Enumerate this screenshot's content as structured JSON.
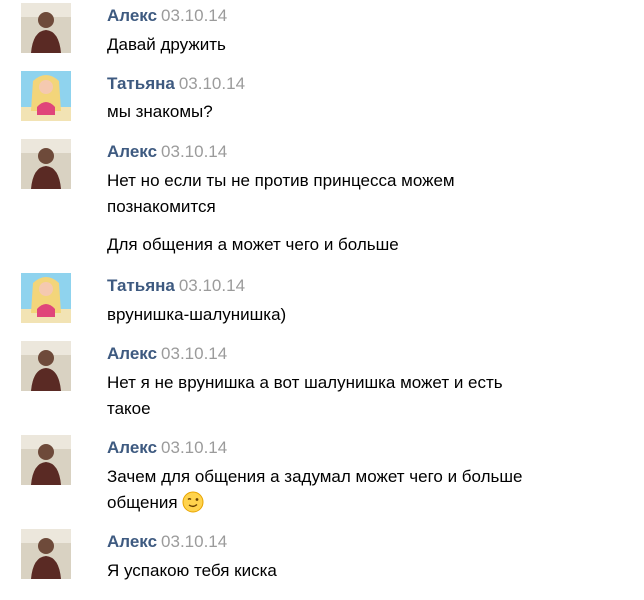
{
  "messages": [
    {
      "author": "Алекс",
      "date": "03.10.14",
      "avatar": "man-avatar-icon",
      "lines": [
        "Давай дружить"
      ]
    },
    {
      "author": "Татьяна",
      "date": "03.10.14",
      "avatar": "woman-avatar-icon",
      "lines": [
        "мы знакомы?"
      ]
    },
    {
      "author": "Алекс",
      "date": "03.10.14",
      "avatar": "man-avatar-icon",
      "lines": [
        "Нет но если ты не против принцесса можем",
        "познакомится",
        "Для общения а может чего и больше"
      ]
    },
    {
      "author": "Татьяна",
      "date": "03.10.14",
      "avatar": "woman-avatar-icon",
      "lines": [
        "врунишка-шалунишка)"
      ]
    },
    {
      "author": "Алекс",
      "date": "03.10.14",
      "avatar": "man-avatar-icon",
      "lines": [
        "Нет я не врунишка а вот шалунишка может и есть",
        "такое"
      ]
    },
    {
      "author": "Алекс",
      "date": "03.10.14",
      "avatar": "man-avatar-icon",
      "lines": [
        "Зачем для общения а задумал может чего и больше",
        "общения"
      ],
      "emoji": "wink-emoji-icon"
    },
    {
      "author": "Алекс",
      "date": "03.10.14",
      "avatar": "man-avatar-icon",
      "lines": [
        "Я успакою тебя киска"
      ]
    }
  ]
}
